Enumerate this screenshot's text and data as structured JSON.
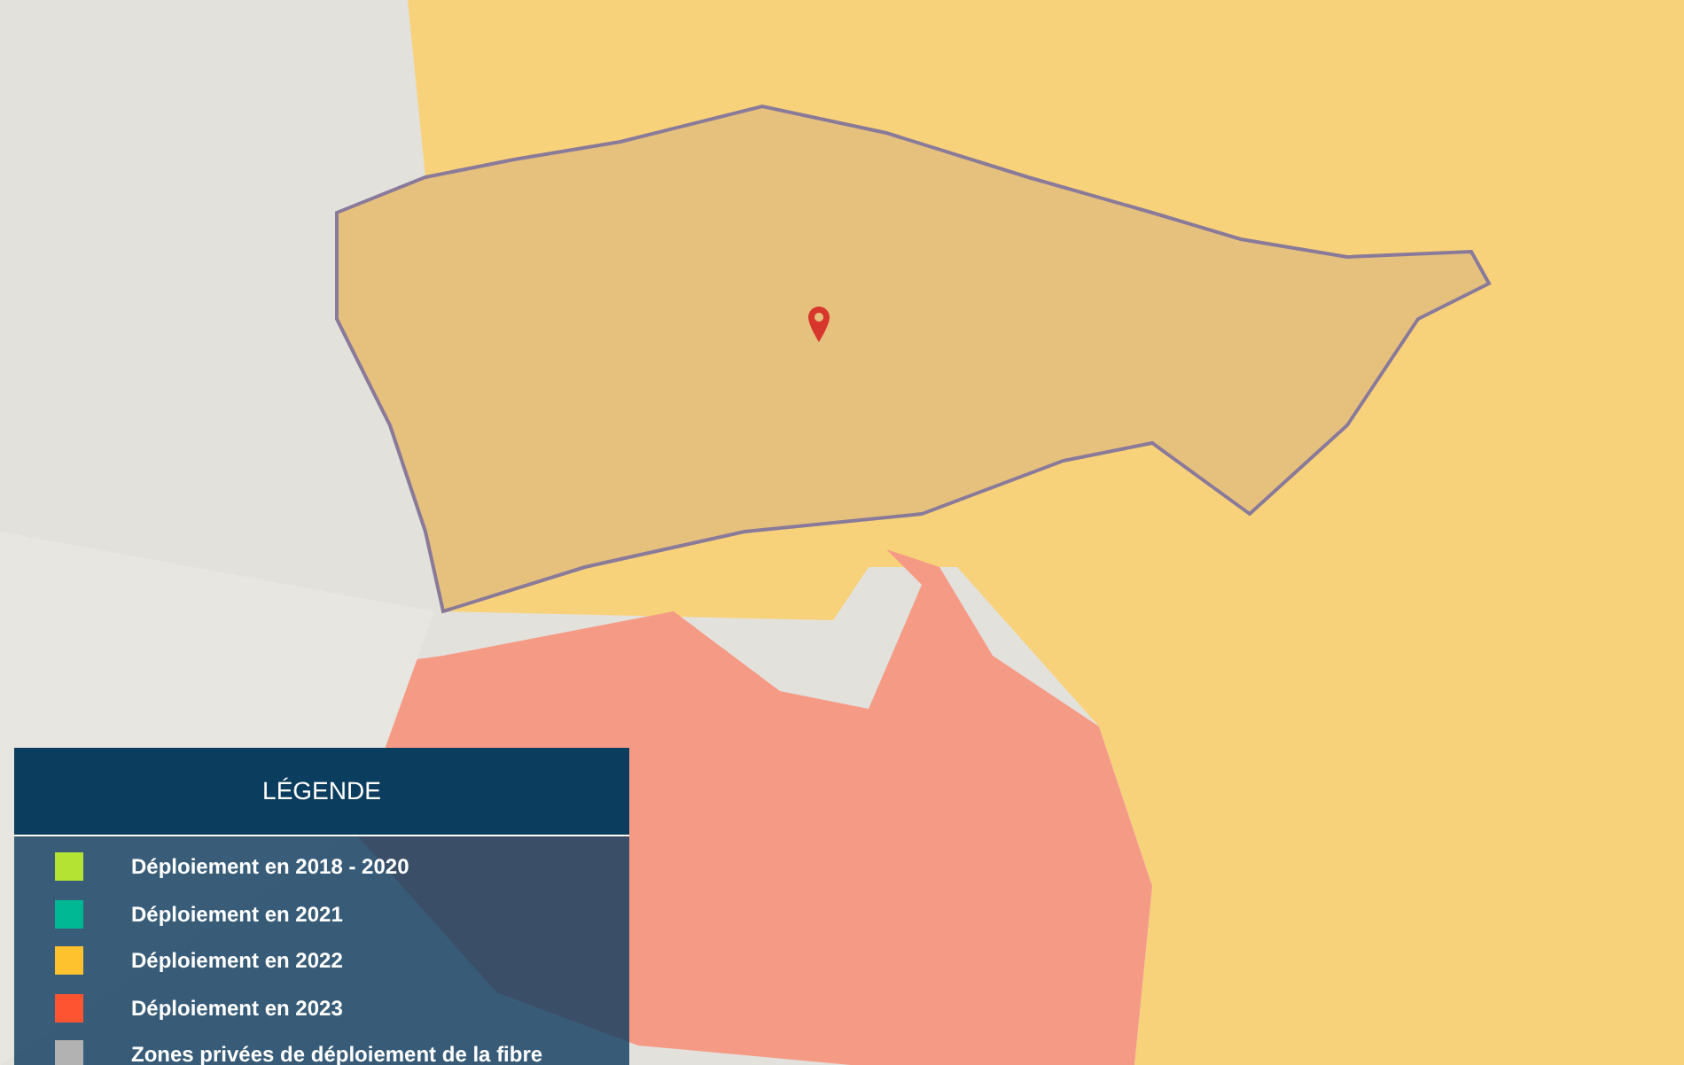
{
  "legend": {
    "title": "LÉGENDE",
    "items": [
      {
        "label": "Déploiement en 2018 - 2020",
        "color": "#b5e334"
      },
      {
        "label": "Déploiement en 2021",
        "color": "#00b894"
      },
      {
        "label": "Déploiement en 2022",
        "color": "#fec22f"
      },
      {
        "label": "Déploiement en 2023",
        "color": "#fe5432"
      },
      {
        "label": "Zones privées de déploiement de la fibre",
        "color": "#b2b2b2"
      }
    ]
  }
}
